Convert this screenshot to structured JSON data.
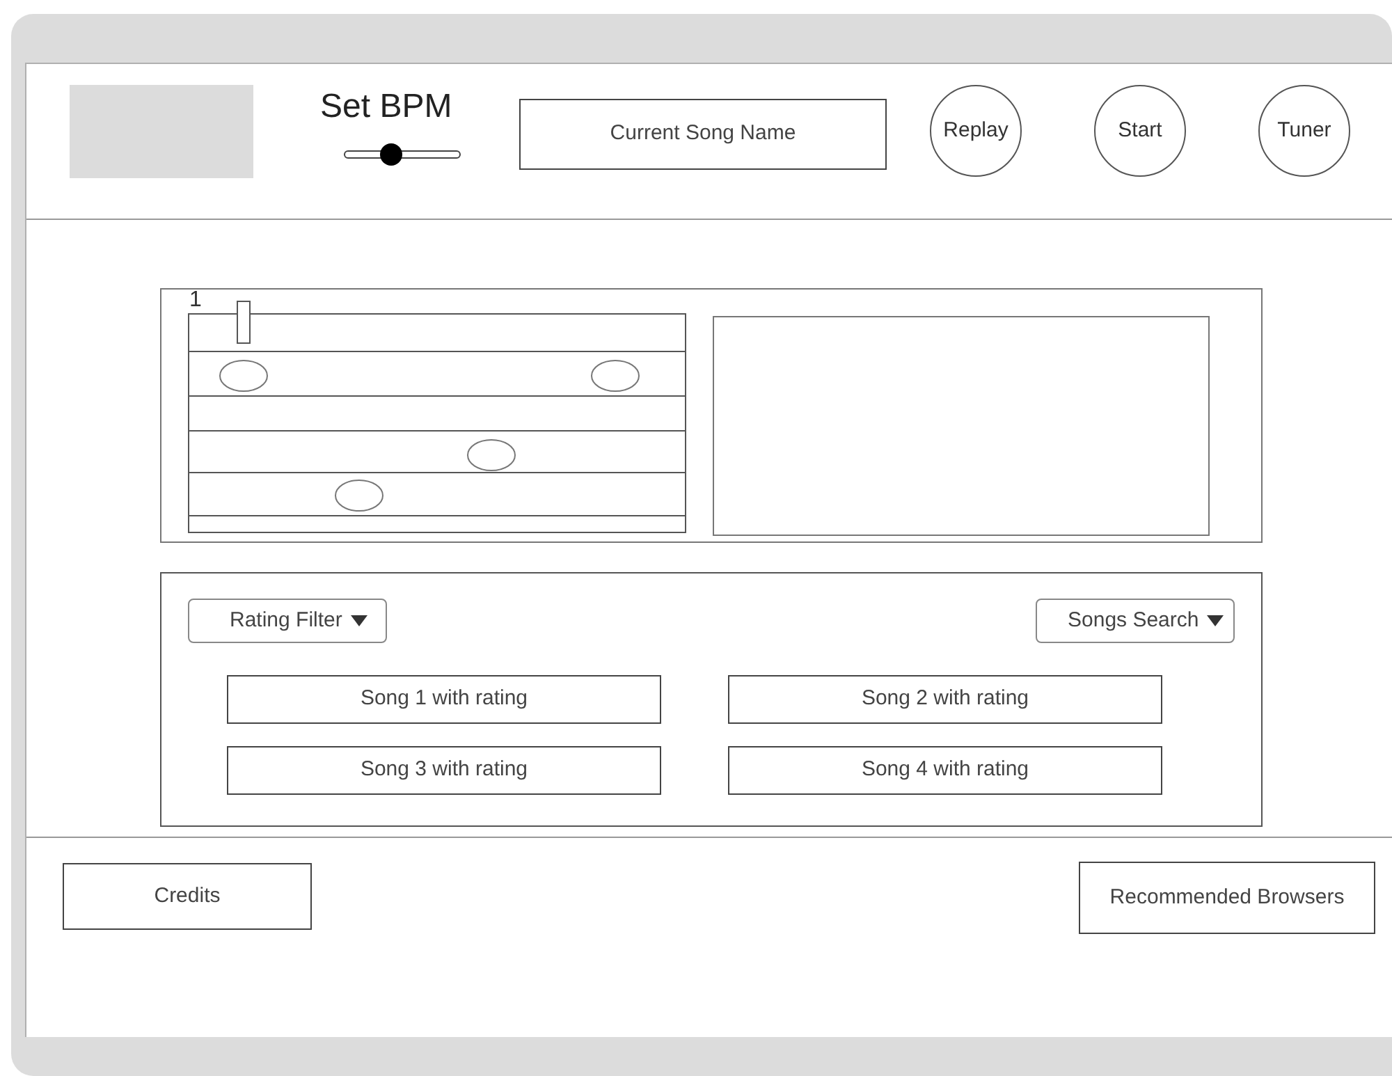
{
  "header": {
    "bpm_label": "Set BPM",
    "bpm_slider": {
      "level": 0.4
    },
    "song_name": "Current Song Name",
    "buttons": [
      "Replay",
      "Start",
      "Tuner"
    ]
  },
  "notation": {
    "measure": "1"
  },
  "filters": [
    {
      "label": "Rating Filter"
    },
    {
      "label": "Songs Search"
    }
  ],
  "songs": [
    "Song 1 with rating",
    "Song 2 with rating",
    "Song 3 with rating",
    "Song 4 with rating"
  ],
  "footer": [
    "Credits",
    "Recommended Browsers"
  ]
}
